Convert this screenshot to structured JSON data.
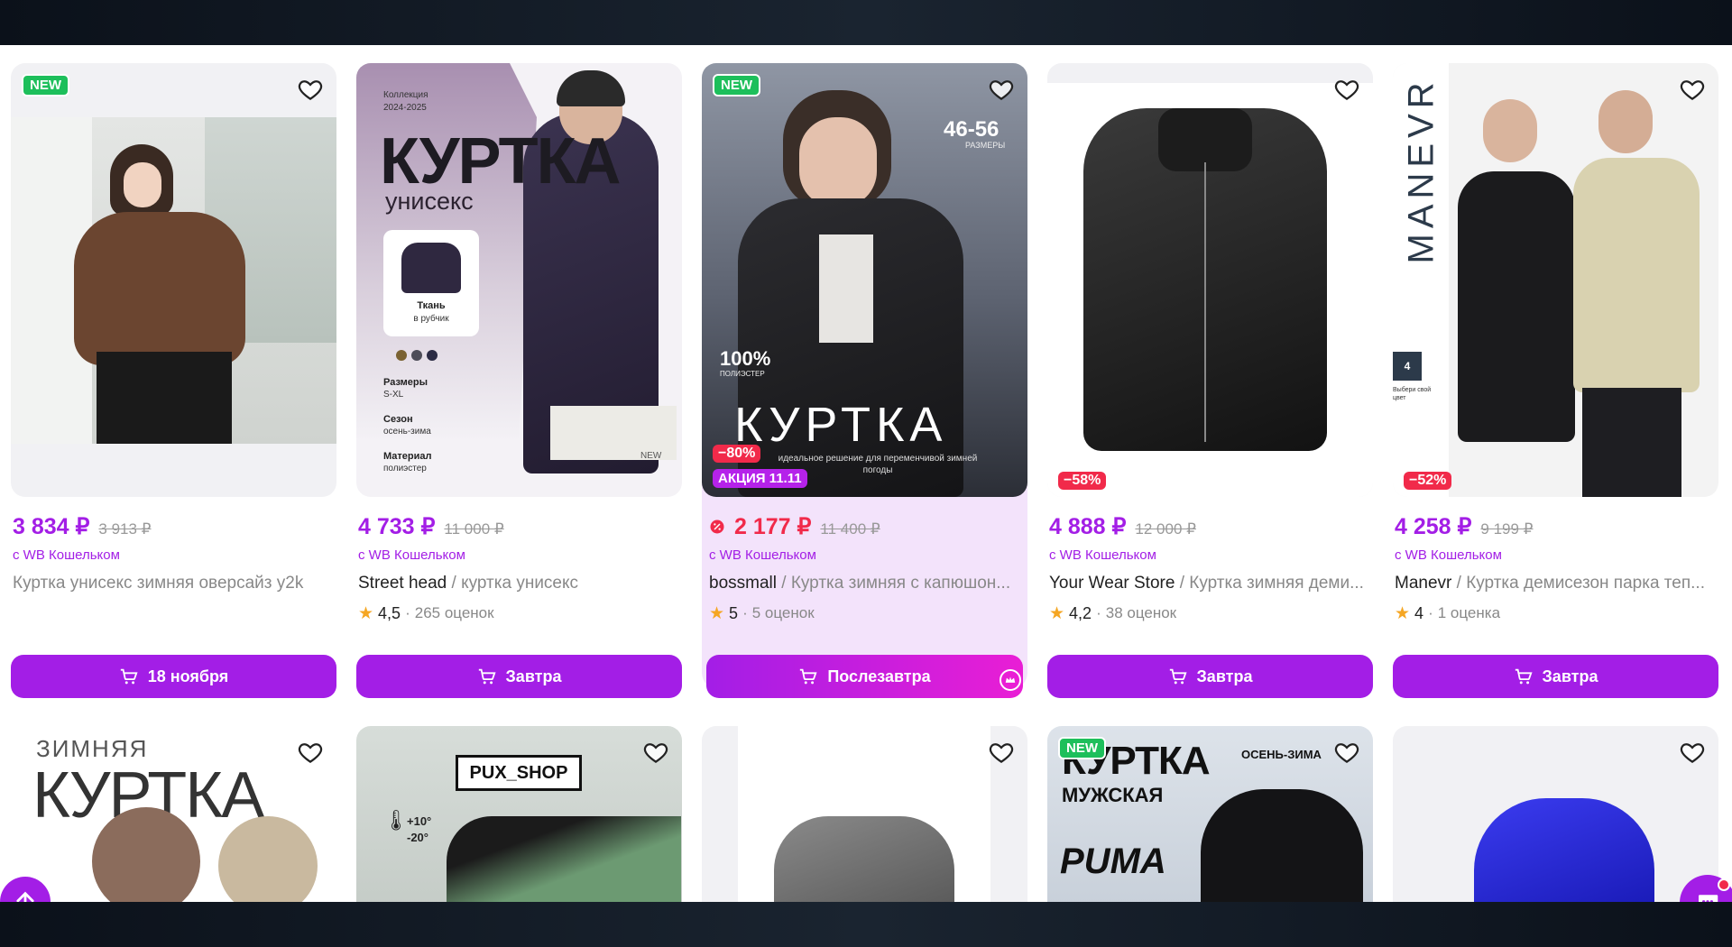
{
  "row1": [
    {
      "badge_new": "NEW",
      "discount": "",
      "promo": "",
      "price": "3 834 ₽",
      "old_price": "3 913 ₽",
      "wallet": "с WB Кошельком",
      "brand": "",
      "name": "Куртка унисекс зимняя оверсайз y2k",
      "rating": "",
      "reviews": "",
      "button": "18 ноября"
    },
    {
      "badge_new": "",
      "discount": "",
      "promo": "",
      "price": "4 733 ₽",
      "old_price": "11 000 ₽",
      "wallet": "с WB Кошельком",
      "brand": "Street head",
      "name": " / куртка унисекс",
      "rating": "4,5",
      "reviews": "265 оценок",
      "button": "Завтра",
      "photo_text": {
        "collection": "Коллекция",
        "season_years": "2024-2025",
        "headline": "КУРТКА",
        "sub": "унисекс",
        "fabric": "Ткань",
        "fabric_sub": "в рубчик",
        "sizes_label": "Размеры",
        "sizes": "S-XL",
        "season_label": "Сезон",
        "season": "осень-зима",
        "material_label": "Материал",
        "material": "полиэстер",
        "new_tag": "NEW"
      }
    },
    {
      "badge_new": "NEW",
      "discount": "−80%",
      "promo": "АКЦИЯ 11.11",
      "price": "2 177 ₽",
      "old_price": "11 400 ₽",
      "wallet": "с WB Кошельком",
      "brand": "bossmall",
      "name": " / Куртка зимняя с капюшон...",
      "rating": "5",
      "reviews": "5 оценок",
      "button": "Послезавтра",
      "photo_text": {
        "sizes": "46-56",
        "sizes_label": "РАЗМЕРЫ",
        "poly": "100%",
        "poly_label": "ПОЛИЭСТЕР",
        "headline": "КУРТКА",
        "tagline": "идеальное решение для переменчивой зимней погоды"
      }
    },
    {
      "badge_new": "",
      "discount": "−58%",
      "promo": "",
      "price": "4 888 ₽",
      "old_price": "12 000 ₽",
      "wallet": "с WB Кошельком",
      "brand": "Your Wear Store",
      "name": " / Куртка зимняя деми...",
      "rating": "4,2",
      "reviews": "38 оценок",
      "button": "Завтра"
    },
    {
      "badge_new": "",
      "discount": "−52%",
      "promo": "",
      "price": "4 258 ₽",
      "old_price": "9 199 ₽",
      "wallet": "с WB Кошельком",
      "brand": "Manevr",
      "name": " / Куртка демисезон парка теп...",
      "rating": "4",
      "reviews": "1 оценка",
      "button": "Завтра",
      "photo_text": {
        "logo": "MANEVR",
        "colors_count": "4",
        "colors_label": "Выбери свой цвет"
      }
    }
  ],
  "row2": [
    {
      "badge_new": "",
      "photo_text": {
        "line1": "ЗИМНЯЯ",
        "line2": "КУРТКА"
      }
    },
    {
      "badge_new": "",
      "photo_text": {
        "shop": "PUX_SHOP",
        "temp_hi": "+10°",
        "temp_lo": "-20°"
      }
    },
    {
      "badge_new": "",
      "photo_text": {}
    },
    {
      "badge_new": "NEW",
      "photo_text": {
        "headline": "КУРТКА",
        "season": "ОСЕНЬ-ЗИМА",
        "sub": "МУЖСКАЯ",
        "logo": "PUMA"
      }
    },
    {
      "badge_new": "",
      "photo_text": {}
    }
  ],
  "colors": {
    "accent": "#a31ee6",
    "discount": "#f12a4a",
    "new": "#1dbf5b",
    "star": "#f5a623"
  }
}
